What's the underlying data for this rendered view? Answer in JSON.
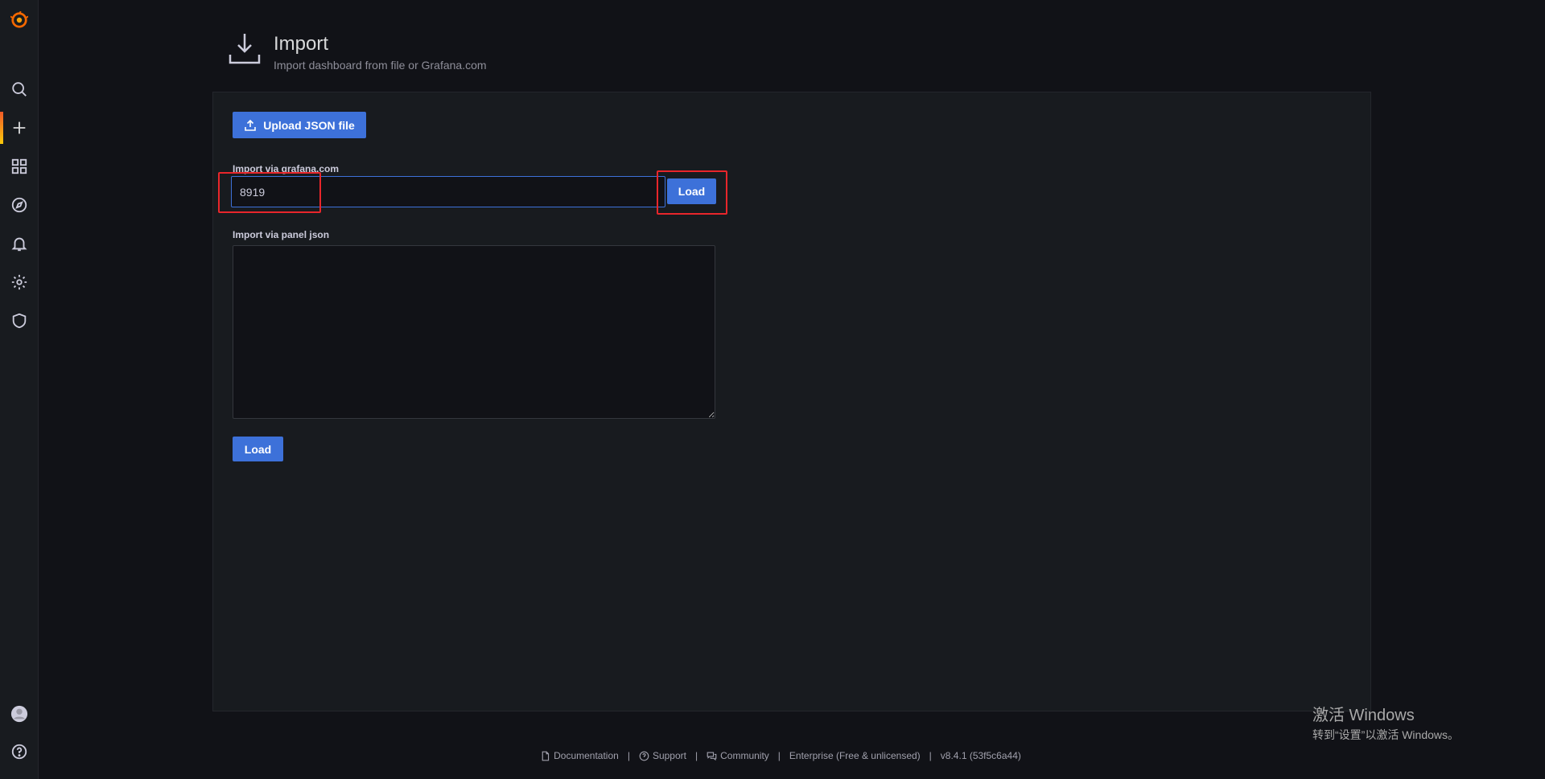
{
  "header": {
    "title": "Import",
    "subtitle": "Import dashboard from file or Grafana.com"
  },
  "upload": {
    "label": "Upload JSON file"
  },
  "gcom": {
    "label": "Import via grafana.com",
    "value": "8919",
    "load_label": "Load"
  },
  "panel_json": {
    "label": "Import via panel json",
    "value": "",
    "load_label": "Load"
  },
  "footer": {
    "documentation": "Documentation",
    "support": "Support",
    "community": "Community",
    "edition": "Enterprise (Free & unlicensed)",
    "version": "v8.4.1 (53f5c6a44)",
    "separator": "|"
  },
  "watermark": {
    "line1": "激活 Windows",
    "line2": "转到“设置”以激活 Windows。"
  },
  "colors": {
    "accent": "#3d71d9",
    "highlight": "#e8262b",
    "background": "#111217",
    "panel": "#181b1f"
  },
  "sidebar_icons": [
    "grafana-logo-icon",
    "search-icon",
    "plus-icon",
    "dashboards-icon",
    "explore-icon",
    "alerting-icon",
    "gear-icon",
    "shield-icon",
    "avatar",
    "help-icon"
  ]
}
